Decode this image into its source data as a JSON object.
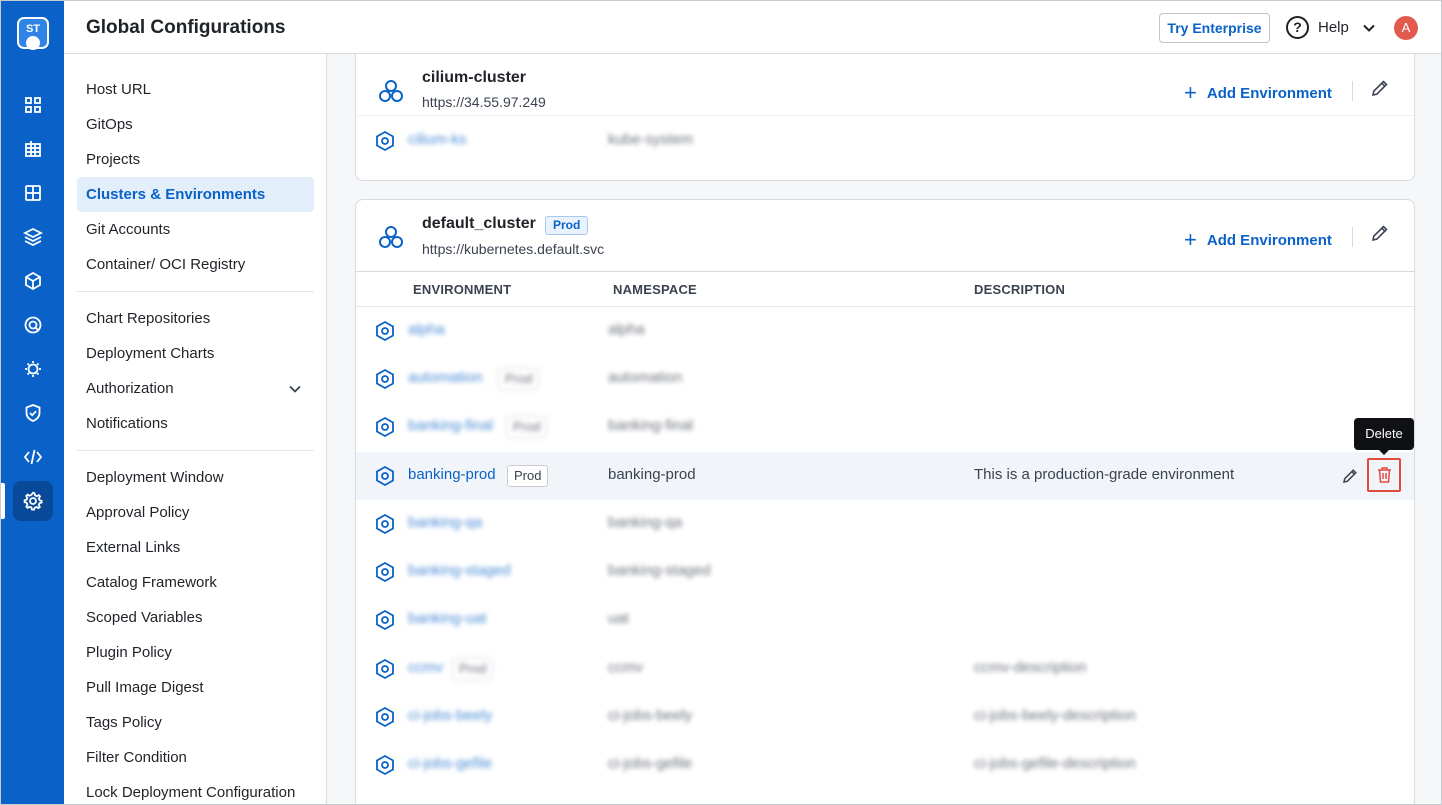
{
  "header": {
    "title": "Global Configurations",
    "try_enterprise": "Try Enterprise",
    "help_label": "Help",
    "avatar_initial": "A"
  },
  "rail": {
    "logo_text": "ST",
    "icons": [
      "apps-icon",
      "grid-table-icon",
      "layout-icon",
      "stack-icon",
      "package-icon",
      "target-icon",
      "bug-icon",
      "shield-icon",
      "code-icon",
      "gear-icon"
    ],
    "active_icon": "gear-icon"
  },
  "settings_nav": {
    "group1": [
      "Host URL",
      "GitOps",
      "Projects",
      "Clusters & Environments",
      "Git Accounts",
      "Container/ OCI Registry"
    ],
    "group2": [
      "Chart Repositories",
      "Deployment Charts",
      "Authorization",
      "Notifications"
    ],
    "group3": [
      "Deployment Window",
      "Approval Policy",
      "External Links",
      "Catalog Framework",
      "Scoped Variables",
      "Plugin Policy",
      "Pull Image Digest",
      "Tags Policy",
      "Filter Condition",
      "Lock Deployment Configuration"
    ],
    "active": "Clusters & Environments"
  },
  "clusters": [
    {
      "name": "cilium-cluster",
      "url": "https://34.55.97.249",
      "add_env_label": "Add Environment",
      "environments": [
        {
          "name": "cilium-ks",
          "namespace": "kube-system",
          "description": "",
          "prod": false
        }
      ]
    },
    {
      "name": "default_cluster",
      "tag": "Prod",
      "url": "https://kubernetes.default.svc",
      "add_env_label": "Add Environment",
      "columns": [
        "ENVIRONMENT",
        "NAMESPACE",
        "DESCRIPTION"
      ],
      "environments": [
        {
          "name": "alpha",
          "namespace": "alpha",
          "description": "",
          "tag": ""
        },
        {
          "name": "automation",
          "namespace": "automation",
          "description": "",
          "tag": "Prod"
        },
        {
          "name": "banking-final",
          "namespace": "banking-final",
          "description": "",
          "tag": "Prod"
        },
        {
          "name": "banking-prod",
          "namespace": "banking-prod",
          "description": "This is a production-grade environment",
          "tag": "Prod"
        },
        {
          "name": "banking-qa",
          "namespace": "banking-qa",
          "description": "",
          "tag": ""
        },
        {
          "name": "banking-staged",
          "namespace": "banking-staged",
          "description": "",
          "tag": ""
        },
        {
          "name": "banking-uat",
          "namespace": "uat",
          "description": "",
          "tag": ""
        },
        {
          "name": "ccmv",
          "namespace": "ccmv",
          "description": "ccmv-description",
          "tag": "Prod"
        },
        {
          "name": "ci-jobs-beely",
          "namespace": "ci-jobs-beely",
          "description": "ci-jobs-beely-description",
          "tag": ""
        },
        {
          "name": "ci-jobs-gefile",
          "namespace": "ci-jobs-gefile",
          "description": "ci-jobs-gefile-description",
          "tag": ""
        }
      ]
    }
  ],
  "tooltip": "Delete",
  "colors": {
    "brand": "#0a62c8",
    "danger": "#e04a3f",
    "rail_bg": "#0a62c8"
  }
}
